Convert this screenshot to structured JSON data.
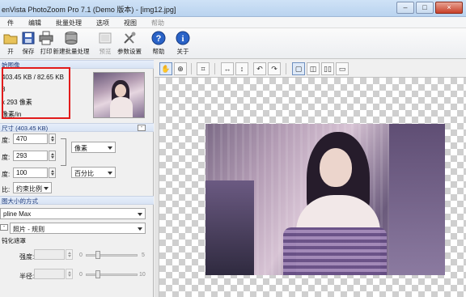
{
  "window": {
    "title": "enVista PhotoZoom Pro 7.1 (Demo 版本) - [img12.jpg]"
  },
  "menu": [
    "件",
    "编辑",
    "批量处理",
    "选项",
    "视图",
    "帮助"
  ],
  "toolbar": {
    "buttons": [
      {
        "label": "开",
        "icon": "folder-open-icon",
        "disabled": false
      },
      {
        "label": "保存",
        "icon": "save-icon",
        "disabled": false
      },
      {
        "label": "打印",
        "icon": "printer-icon",
        "disabled": false
      },
      {
        "label": "新建批量处理",
        "icon": "batch-icon",
        "disabled": false
      },
      {
        "label": "预览",
        "icon": "preview-icon",
        "disabled": true
      },
      {
        "label": "参数设置",
        "icon": "settings-icon",
        "disabled": false
      },
      {
        "label": "帮助",
        "icon": "help-icon",
        "disabled": false
      },
      {
        "label": "关于",
        "icon": "info-icon",
        "disabled": false
      }
    ]
  },
  "source": {
    "header": "始图像",
    "size_line": "403.45 KB / 82.65 KB",
    "depth_line": "8",
    "dims_line": "x 293 像素",
    "res_line": "像素/in"
  },
  "newsize": {
    "header": "尺寸 (403.45 KB)",
    "width_label": "度:",
    "width_value": "470",
    "height_label": "度:",
    "height_value": "293",
    "unit": "像素",
    "scale_label": "度:",
    "scale_value": "100",
    "scale_unit": "百分比",
    "ratio_label": "比:",
    "ratio_value": "约束比例",
    "resize_header": "图大小的方式",
    "method": "pline Max",
    "preset": "照片 - 规则"
  },
  "sharpen": {
    "header": "钝化遮罩",
    "strength_label": "强度:",
    "strength_min": "0",
    "strength_max": "5",
    "radius_label": "半径:",
    "radius_min": "0",
    "radius_max": "10"
  },
  "colors": {
    "accent": "#e21b1b",
    "titlebar": "#c4dbf3"
  }
}
